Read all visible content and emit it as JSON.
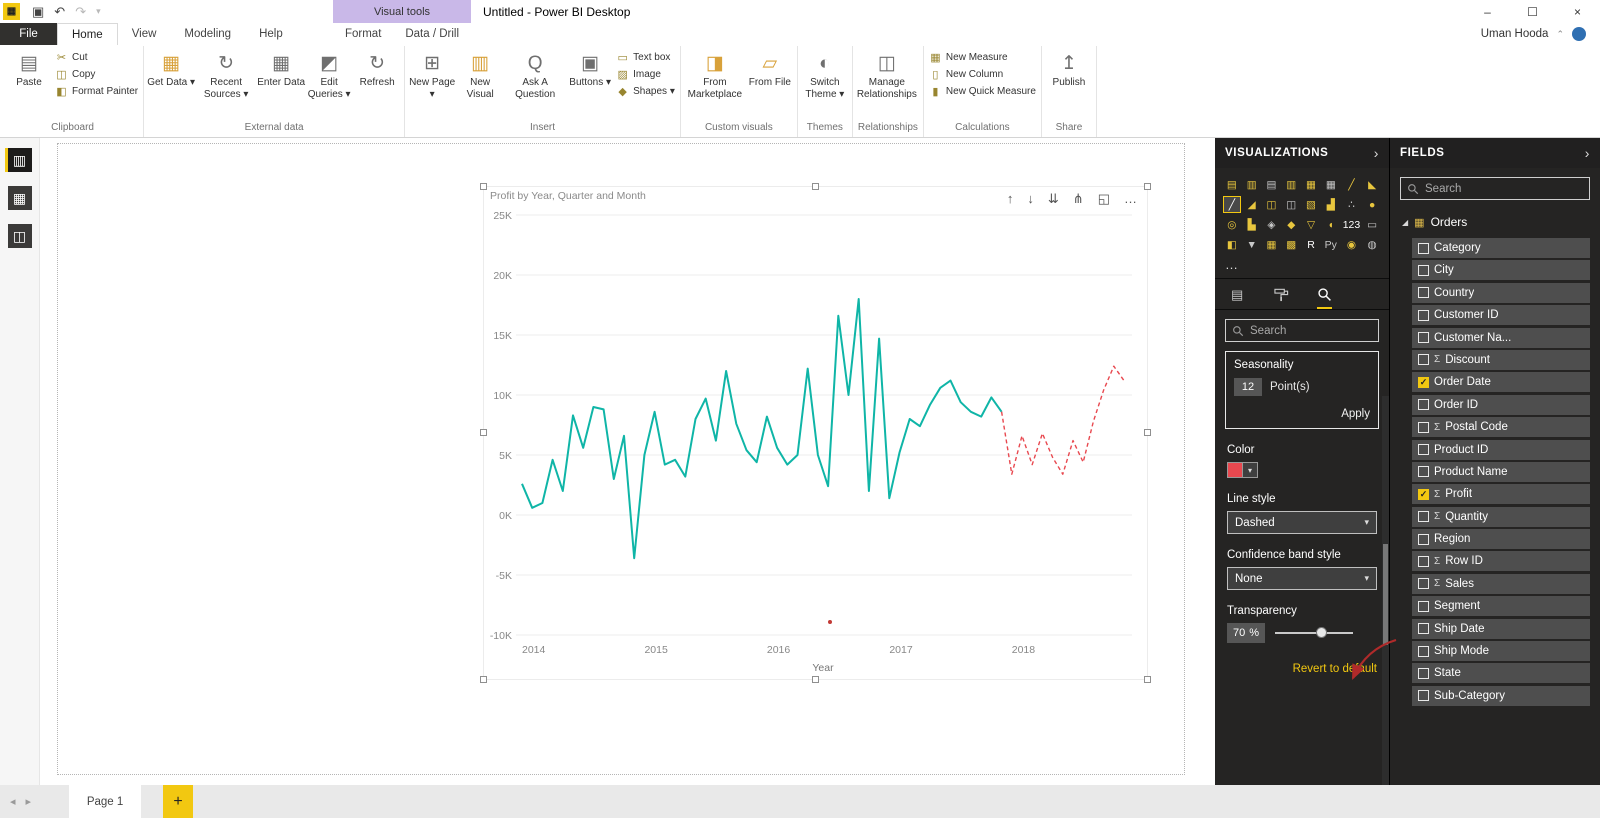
{
  "colors": {
    "accent_yellow": "#F2C811",
    "contextual_purple": "#C9B8E8",
    "panel_dark": "#252423",
    "field_row_gray": "#4E4E4E",
    "teal_line": "#0FB5A7",
    "forecast_red": "#E8484F",
    "annotation_red": "#B02A2A",
    "palette": {
      "y": "#E8C63E",
      "g": "#C8C8C8",
      "w": "#FFFFFF"
    }
  },
  "glyphs": {
    "app": "▦",
    "save": "▣",
    "undo": "↶",
    "redo": "↷",
    "caret_down": "▾",
    "minimize": "–",
    "maximize": "☐",
    "close": "×",
    "panel_chevron": "›",
    "check": "✓",
    "sigma": "Σ",
    "expander": "◢",
    "table_icon": "▦",
    "prev": "◂",
    "next": "▸",
    "plus": "+",
    "ellipsis": "…",
    "user_chevron": "⌃"
  },
  "titlebar": {
    "contextual_header": "Visual tools",
    "title": "Untitled - Power BI Desktop",
    "user": "Uman Hooda"
  },
  "ribbon": {
    "tabs": [
      "File",
      "Home",
      "View",
      "Modeling",
      "Help"
    ],
    "contextual": {
      "tabs": [
        "Format",
        "Data / Drill"
      ]
    },
    "groups": [
      {
        "label": "Clipboard",
        "big": [
          {
            "label": "Paste",
            "icon": "▤"
          }
        ],
        "small": [
          {
            "label": "Cut",
            "icon": "✂"
          },
          {
            "label": "Copy",
            "icon": "◫"
          },
          {
            "label": "Format Painter",
            "icon": "◧"
          }
        ]
      },
      {
        "label": "External data",
        "big": [
          {
            "label": "Get Data",
            "icon": "▦",
            "caret": true,
            "color": "#D8A13A"
          },
          {
            "label": "Recent Sources",
            "icon": "↻",
            "caret": true
          },
          {
            "label": "Enter Data",
            "icon": "▦"
          },
          {
            "label": "Edit Queries",
            "icon": "◩",
            "caret": true
          },
          {
            "label": "Refresh",
            "icon": "↻"
          }
        ]
      },
      {
        "label": "Insert",
        "big": [
          {
            "label": "New Page",
            "icon": "⊞",
            "caret": true
          },
          {
            "label": "New Visual",
            "icon": "▥",
            "color": "#D8A13A"
          },
          {
            "label": "Ask A Question",
            "icon": "Q"
          },
          {
            "label": "Buttons",
            "icon": "▣",
            "caret": true
          }
        ],
        "small": [
          {
            "label": "Text box",
            "icon": "▭"
          },
          {
            "label": "Image",
            "icon": "▨"
          },
          {
            "label": "Shapes",
            "icon": "◆",
            "caret": true
          }
        ]
      },
      {
        "label": "Custom visuals",
        "big": [
          {
            "label": "From Marketplace",
            "icon": "◨",
            "color": "#D8A13A"
          },
          {
            "label": "From File",
            "icon": "▱",
            "color": "#D8A13A"
          }
        ]
      },
      {
        "label": "Themes",
        "big": [
          {
            "label": "Switch Theme",
            "icon": "◐",
            "caret": true
          }
        ]
      },
      {
        "label": "Relationships",
        "big": [
          {
            "label": "Manage Relationships",
            "icon": "◫"
          }
        ]
      },
      {
        "label": "Calculations",
        "small": [
          {
            "label": "New Measure",
            "icon": "▦"
          },
          {
            "label": "New Column",
            "icon": "▯"
          },
          {
            "label": "New Quick Measure",
            "icon": "▮"
          }
        ]
      },
      {
        "label": "Share",
        "big": [
          {
            "label": "Publish",
            "icon": "↥"
          }
        ]
      }
    ]
  },
  "leftnav": [
    {
      "name": "report-view",
      "glyph": "▥",
      "active": true
    },
    {
      "name": "data-view",
      "glyph": "▦",
      "active": false
    },
    {
      "name": "model-view",
      "glyph": "◫",
      "active": false
    }
  ],
  "visual_toolbar": [
    {
      "name": "drill-up-icon",
      "glyph": "↑"
    },
    {
      "name": "drill-down-icon",
      "glyph": "↓"
    },
    {
      "name": "expand-next-level-icon",
      "glyph": "⇊"
    },
    {
      "name": "drill-mode-icon",
      "glyph": "⋔"
    },
    {
      "name": "focus-mode-icon",
      "glyph": "◱"
    },
    {
      "name": "more-options-icon",
      "glyph": "…"
    }
  ],
  "chart_data": {
    "type": "line",
    "title": "Profit by Year, Quarter and Month",
    "xlabel": "Year",
    "y_unit": "K",
    "ylim": [
      -10,
      25
    ],
    "grid": true,
    "y_ticks": [
      {
        "v": 25,
        "label": "25K"
      },
      {
        "v": 20,
        "label": "20K"
      },
      {
        "v": 15,
        "label": "15K"
      },
      {
        "v": 10,
        "label": "10K"
      },
      {
        "v": 5,
        "label": "5K"
      },
      {
        "v": 0,
        "label": "0K"
      },
      {
        "v": -5,
        "label": "-5K"
      },
      {
        "v": -10,
        "label": "-10K"
      }
    ],
    "x_ticks": [
      {
        "m": 0,
        "label": "2014"
      },
      {
        "m": 12,
        "label": "2015"
      },
      {
        "m": 24,
        "label": "2016"
      },
      {
        "m": 36,
        "label": "2017"
      },
      {
        "m": 48,
        "label": "2018"
      }
    ],
    "series": [
      {
        "name": "Profit",
        "style": "solid",
        "color": "#0FB5A7",
        "values_k": [
          2.6,
          0.6,
          1.0,
          4.6,
          2.0,
          8.3,
          5.6,
          9.0,
          8.8,
          3.0,
          6.6,
          -3.6,
          5.0,
          8.6,
          4.2,
          4.6,
          3.2,
          8.0,
          9.7,
          6.2,
          12.0,
          7.6,
          5.4,
          4.4,
          8.2,
          5.6,
          4.2,
          5.0,
          12.2,
          5.0,
          2.4,
          16.6,
          10.0,
          18.0,
          2.0,
          14.7,
          1.4,
          5.2,
          8.0,
          7.4,
          9.2,
          10.6,
          11.2,
          9.4,
          8.6,
          8.2,
          9.8,
          8.6
        ]
      },
      {
        "name": "Forecast",
        "style": "dashed",
        "color": "#E8484F",
        "values_k": [
          3.4,
          6.6,
          4.2,
          6.8,
          4.8,
          3.4,
          6.2,
          4.4,
          7.8,
          10.4,
          12.4,
          11.2
        ]
      }
    ]
  },
  "visualizations_panel": {
    "title": "VISUALIZATIONS",
    "search_placeholder": "Search",
    "more": "…",
    "icons": [
      {
        "name": "stacked-bar-chart",
        "glyph": "▤",
        "c": "y"
      },
      {
        "name": "stacked-column-chart",
        "glyph": "▥",
        "c": "y"
      },
      {
        "name": "clustered-bar-chart",
        "glyph": "▤",
        "c": "g"
      },
      {
        "name": "clustered-column-chart",
        "glyph": "▥",
        "c": "y"
      },
      {
        "name": "100-stacked-bar-chart",
        "glyph": "▦",
        "c": "y"
      },
      {
        "name": "100-stacked-column-chart",
        "glyph": "▦",
        "c": "g"
      },
      {
        "name": "line-chart",
        "glyph": "╱",
        "c": "y"
      },
      {
        "name": "area-chart",
        "glyph": "◣",
        "c": "y"
      },
      {
        "name": "line-chart-selected",
        "glyph": "╱",
        "c": "w",
        "selected": true
      },
      {
        "name": "stacked-area-chart",
        "glyph": "◢",
        "c": "y"
      },
      {
        "name": "line-and-stacked-column-chart",
        "glyph": "◫",
        "c": "y"
      },
      {
        "name": "line-and-clustered-column-chart",
        "glyph": "◫",
        "c": "g"
      },
      {
        "name": "ribbon-chart",
        "glyph": "▧",
        "c": "y"
      },
      {
        "name": "waterfall-chart",
        "glyph": "▟",
        "c": "y"
      },
      {
        "name": "scatter-chart",
        "glyph": "∴",
        "c": "g"
      },
      {
        "name": "pie-chart",
        "glyph": "●",
        "c": "y"
      },
      {
        "name": "donut-chart",
        "glyph": "◎",
        "c": "y"
      },
      {
        "name": "treemap",
        "glyph": "▙",
        "c": "y"
      },
      {
        "name": "map",
        "glyph": "◈",
        "c": "g"
      },
      {
        "name": "filled-map",
        "glyph": "◆",
        "c": "y"
      },
      {
        "name": "funnel",
        "glyph": "▽",
        "c": "y"
      },
      {
        "name": "gauge",
        "glyph": "◖",
        "c": "y"
      },
      {
        "name": "card",
        "glyph": "123",
        "c": "w"
      },
      {
        "name": "multi-row-card",
        "glyph": "▭",
        "c": "g"
      },
      {
        "name": "kpi",
        "glyph": "◧",
        "c": "y"
      },
      {
        "name": "slicer",
        "glyph": "▼",
        "c": "g"
      },
      {
        "name": "table",
        "glyph": "▦",
        "c": "y"
      },
      {
        "name": "matrix",
        "glyph": "▩",
        "c": "y"
      },
      {
        "name": "r-script-visual",
        "glyph": "R",
        "c": "w"
      },
      {
        "name": "python-visual",
        "glyph": "Py",
        "c": "g"
      },
      {
        "name": "key-influencers",
        "glyph": "◉",
        "c": "y"
      },
      {
        "name": "arcgis-map",
        "glyph": "◍",
        "c": "g"
      }
    ]
  },
  "analytics_pane": {
    "search_placeholder": "Search",
    "seasonality": {
      "label": "Seasonality",
      "value": "12",
      "unit": "Point(s)",
      "apply_label": "Apply"
    },
    "color_label": "Color",
    "color_value": "#E8484F",
    "line_style": {
      "label": "Line style",
      "value": "Dashed"
    },
    "confidence": {
      "label": "Confidence band style",
      "value": "None"
    },
    "transparency": {
      "label": "Transparency",
      "value": "70",
      "unit": "%"
    },
    "revert_label": "Revert to default"
  },
  "fields_panel": {
    "title": "FIELDS",
    "search_placeholder": "Search",
    "table_name": "Orders",
    "items": [
      {
        "label": "Category"
      },
      {
        "label": "City"
      },
      {
        "label": "Country"
      },
      {
        "label": "Customer ID"
      },
      {
        "label": "Customer Na..."
      },
      {
        "label": "Discount",
        "sigma": true
      },
      {
        "label": "Order Date",
        "checked": true
      },
      {
        "label": "Order ID"
      },
      {
        "label": "Postal Code",
        "sigma": true
      },
      {
        "label": "Product ID"
      },
      {
        "label": "Product Name"
      },
      {
        "label": "Profit",
        "sigma": true,
        "checked": true
      },
      {
        "label": "Quantity",
        "sigma": true
      },
      {
        "label": "Region"
      },
      {
        "label": "Row ID",
        "sigma": true
      },
      {
        "label": "Sales",
        "sigma": true
      },
      {
        "label": "Segment"
      },
      {
        "label": "Ship Date"
      },
      {
        "label": "Ship Mode"
      },
      {
        "label": "State"
      },
      {
        "label": "Sub-Category"
      }
    ]
  },
  "pagesbar": {
    "page_label": "Page 1"
  }
}
